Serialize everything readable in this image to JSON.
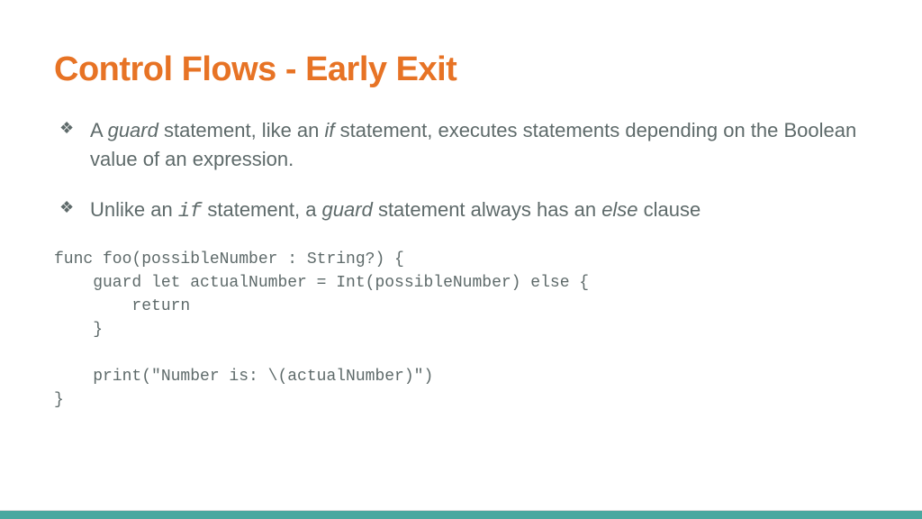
{
  "title": "Control Flows - Early Exit",
  "bullets": [
    {
      "pre1": "A ",
      "em1": "guard",
      "mid1": " statement, like an ",
      "em2": "if",
      "post": " statement, executes statements depending on the Boolean value of an expression."
    },
    {
      "pre1": "Unlike an ",
      "em1": "if",
      "mid1": " statement, a ",
      "em2": "guard",
      "mid2": " statement always has an ",
      "em3": "else",
      "post": " clause"
    }
  ],
  "code": "func foo(possibleNumber : String?) {\n    guard let actualNumber = Int(possibleNumber) else {\n        return\n    }\n\n    print(\"Number is: \\(actualNumber)\")\n}",
  "colors": {
    "accent": "#e77325",
    "text": "#5e6a6a",
    "footer": "#4aa8a0"
  }
}
